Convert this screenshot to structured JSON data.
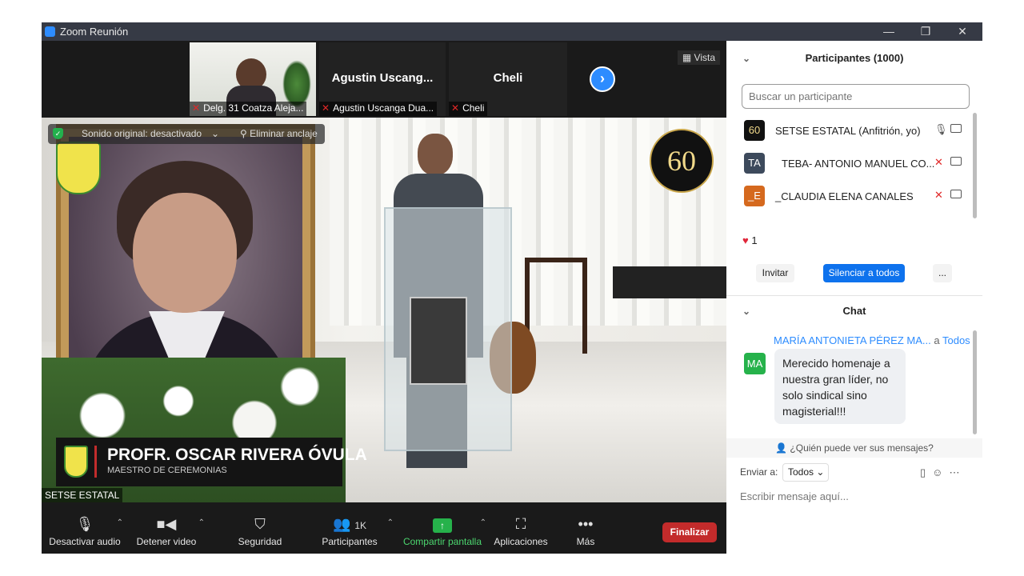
{
  "window": {
    "title": "Zoom Reunión",
    "minimize": "—",
    "restore": "❐",
    "close": "✕"
  },
  "strip": {
    "tiles": [
      {
        "big": "",
        "name": "Delg. 31 Coatza Aleja..."
      },
      {
        "big": "Agustin  Uscang...",
        "name": "Agustin Uscanga Dua..."
      },
      {
        "big": "Cheli",
        "name": "Cheli"
      }
    ],
    "next": "›",
    "view_label": "Vista"
  },
  "stage": {
    "original_sound": "Sonido original: desactivado",
    "unpin": "Eliminar anclaje",
    "anniv": "60",
    "lower_third_name": "PROFR. OSCAR RIVERA ÓVULA",
    "lower_third_role": "MAESTRO DE CEREMONIAS",
    "self_label": "SETSE ESTATAL"
  },
  "toolbar": {
    "audio": "Desactivar audio",
    "video": "Detener video",
    "security": "Seguridad",
    "participants": "Participantes",
    "participants_count": "1K",
    "share": "Compartir pantalla",
    "apps": "Aplicaciones",
    "more": "Más",
    "end": "Finalizar"
  },
  "participants": {
    "title": "Participantes (1000)",
    "search_placeholder": "Buscar un participante",
    "items": [
      {
        "avatar": "60",
        "name": "SETSE ESTATAL (Anfitrión, yo)",
        "color": "#111111"
      },
      {
        "avatar": "TA",
        "name": "TEBA- ANTONIO MANUEL CO...",
        "color": "#3d4a5c"
      },
      {
        "avatar": "_E",
        "name": "_CLAUDIA ELENA CANALES",
        "color": "#d5691e"
      }
    ],
    "reaction_count": "1",
    "invite": "Invitar",
    "mute_all": "Silenciar a todos",
    "more": "..."
  },
  "chat": {
    "title": "Chat",
    "avatar": "MA",
    "from": "MARÍA ANTONIETA PÉREZ MA...",
    "to_prefix": "a",
    "to": "Todos",
    "message": "Merecido homenaje a nuestra gran líder, no solo sindical sino magisterial!!!",
    "who_can_see": "¿Quién puede ver sus mensajes?",
    "send_to_label": "Enviar a:",
    "send_to_value": "Todos",
    "input_placeholder": "Escribir mensaje aquí..."
  }
}
